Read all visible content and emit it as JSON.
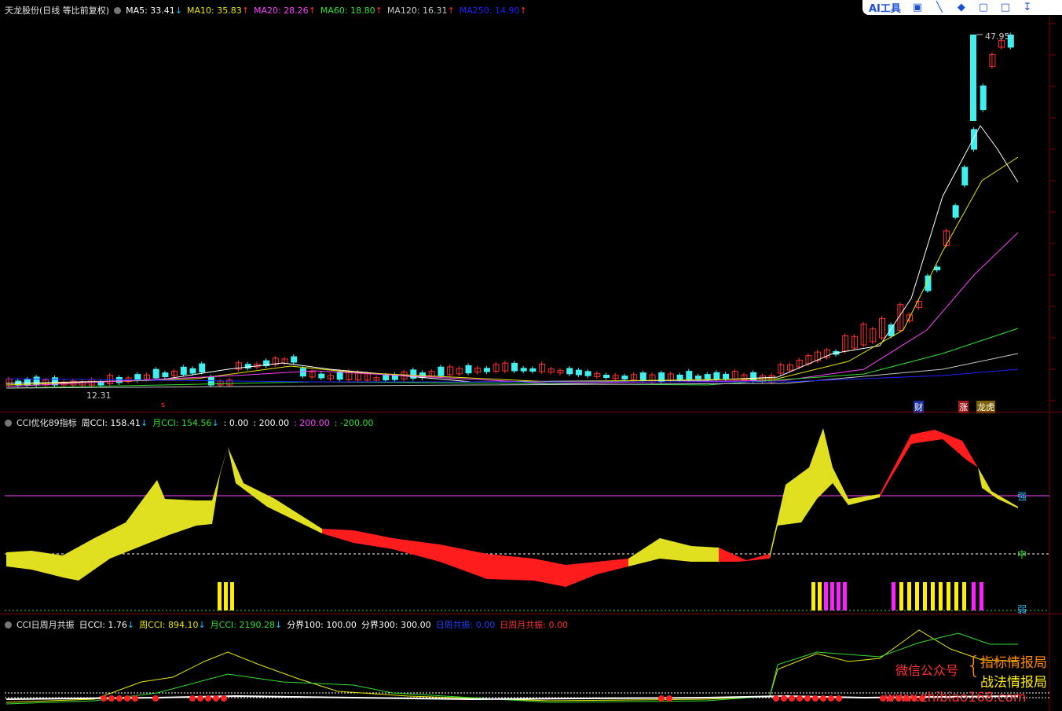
{
  "main": {
    "title": "天龙股份(日线 等比前复权)",
    "ma": [
      {
        "label": "MA5: 33.41",
        "arrow": "↓",
        "color": "#ffffff",
        "arrow_color": "#00c8ff"
      },
      {
        "label": "MA10: 35.83",
        "arrow": "↑",
        "color": "#e8e800",
        "arrow_color": "#ff3030"
      },
      {
        "label": "MA20: 28.26",
        "arrow": "↑",
        "color": "#ff40ff",
        "arrow_color": "#ff3030"
      },
      {
        "label": "MA60: 18.80",
        "arrow": "↑",
        "color": "#30e030",
        "arrow_color": "#ff3030"
      },
      {
        "label": "MA120: 16.31",
        "arrow": "↑",
        "color": "#c8c8c8",
        "arrow_color": "#ff3030"
      },
      {
        "label": "MA250: 14.90",
        "arrow": "↑",
        "color": "#2020ff",
        "arrow_color": "#ff3030"
      }
    ],
    "high_label": "47.95",
    "low_label": "12.31",
    "tags": {
      "cai": "财",
      "zhang": "涨",
      "longhu": "龙虎",
      "s": "s"
    }
  },
  "toolbar": {
    "ai_label": "AI工具"
  },
  "cci1": {
    "title": "CCI优化89指标",
    "items": [
      {
        "label": "周CCI: 158.41",
        "arrow": "↓",
        "color": "#ffffff",
        "arrow_color": "#00c8ff"
      },
      {
        "label": "月CCI: 154.56",
        "arrow": "↓",
        "color": "#30e030",
        "arrow_color": "#00c8ff"
      },
      {
        "label": ": 0.00",
        "arrow": "",
        "color": "#ffffff",
        "arrow_color": ""
      },
      {
        "label": ": 200.00",
        "arrow": "",
        "color": "#ffffff",
        "arrow_color": ""
      },
      {
        "label": ": 200.00",
        "arrow": "",
        "color": "#ff40ff",
        "arrow_color": ""
      },
      {
        "label": ": -200.00",
        "arrow": "",
        "color": "#30e030",
        "arrow_color": ""
      }
    ],
    "axis": {
      "strong": "强",
      "mid": "中",
      "weak": "弱"
    }
  },
  "cci2": {
    "title": "CCI日周月共振",
    "items": [
      {
        "label": "日CCI: 1.76",
        "arrow": "↓",
        "color": "#ffffff",
        "arrow_color": "#00c8ff"
      },
      {
        "label": "周CCI: 894.10",
        "arrow": "↓",
        "color": "#e8e800",
        "arrow_color": "#00c8ff"
      },
      {
        "label": "月CCI: 2190.28",
        "arrow": "↓",
        "color": "#30e030",
        "arrow_color": "#00c8ff"
      },
      {
        "label": "分界100: 100.00",
        "arrow": "",
        "color": "#ffffff",
        "arrow_color": ""
      },
      {
        "label": "分界300: 300.00",
        "arrow": "",
        "color": "#ffffff",
        "arrow_color": ""
      },
      {
        "label": "日周共振: 0.00",
        "arrow": "",
        "color": "#2040ff",
        "arrow_color": ""
      },
      {
        "label": "日周月共振: 0.00",
        "arrow": "",
        "color": "#ff3030",
        "arrow_color": ""
      }
    ]
  },
  "watermark": {
    "wechat": "微信公众号",
    "line1": "指标情报局",
    "line2": "战法情报局",
    "url": "www.zhibiao168.com"
  }
}
